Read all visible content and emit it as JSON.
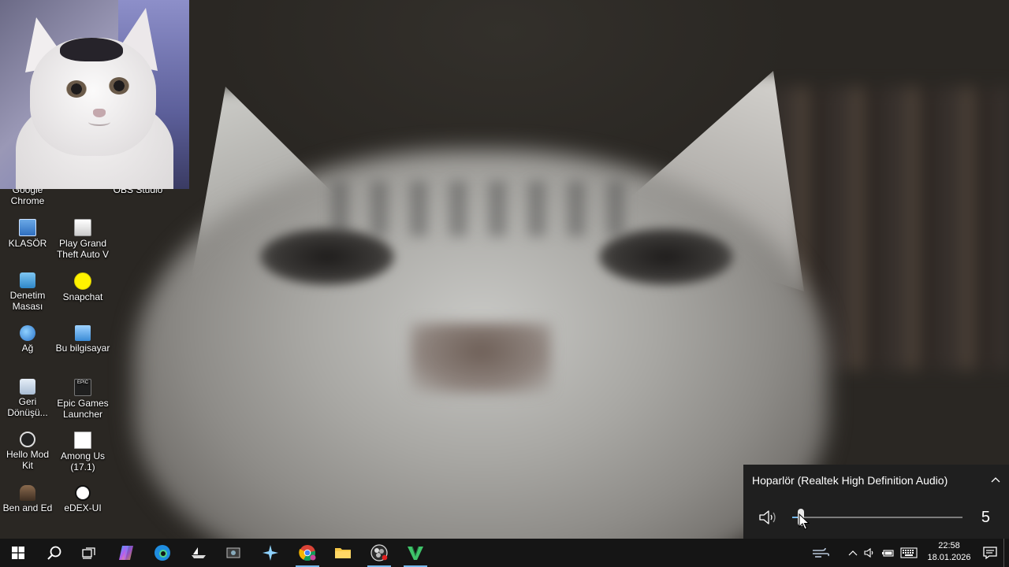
{
  "desktop": {
    "icons": [
      {
        "label": "Google\nChrome",
        "icon": "chrome-icon"
      },
      {
        "label": "OBS Studio",
        "icon": "obs-icon"
      },
      {
        "label": "KLASÖR",
        "icon": "folder-icon"
      },
      {
        "label": "Play Grand Theft Auto V",
        "icon": "gta-icon"
      },
      {
        "label": "Denetim Masası",
        "icon": "control-panel-icon"
      },
      {
        "label": "Snapchat",
        "icon": "snapchat-icon"
      },
      {
        "label": "Ağ",
        "icon": "network-icon"
      },
      {
        "label": "Bu bilgisayar",
        "icon": "this-pc-icon"
      },
      {
        "label": "Geri Dönüşü...",
        "icon": "recycle-bin-icon"
      },
      {
        "label": "Epic Games Launcher",
        "icon": "epic-games-icon"
      },
      {
        "label": "Hello Mod Kit",
        "icon": "hello-mod-kit-icon"
      },
      {
        "label": "Among Us (17.1)",
        "icon": "among-us-icon"
      },
      {
        "label": "Ben and Ed",
        "icon": "ben-and-ed-icon"
      },
      {
        "label": "eDEX-UI",
        "icon": "edex-ui-icon"
      }
    ],
    "epic_badge": "EPIC"
  },
  "volume": {
    "device_name": "Hoparlör (Realtek High Definition Audio)",
    "level": 5,
    "level_text": "5"
  },
  "taskbar": {
    "apps": [
      {
        "name": "start",
        "icon": "windows-start-icon"
      },
      {
        "name": "search",
        "icon": "search-icon"
      },
      {
        "name": "task-view",
        "icon": "task-view-icon"
      },
      {
        "name": "copilot",
        "icon": "copilot-icon"
      },
      {
        "name": "edge",
        "icon": "edge-icon"
      },
      {
        "name": "app-1",
        "icon": "boat-icon"
      },
      {
        "name": "app-2",
        "icon": "screenshot-icon"
      },
      {
        "name": "app-3",
        "icon": "star-app-icon"
      },
      {
        "name": "chrome",
        "icon": "chrome-icon"
      },
      {
        "name": "file-explorer",
        "icon": "folder-icon"
      },
      {
        "name": "obs",
        "icon": "obs-icon"
      },
      {
        "name": "vegas",
        "icon": "vegas-icon"
      }
    ],
    "clock": {
      "time": "22:58",
      "date": "18.01.2026"
    }
  },
  "colors": {
    "accent": "#76b9ed",
    "taskbar": "#151515",
    "flyout": "#1f1f1f"
  }
}
